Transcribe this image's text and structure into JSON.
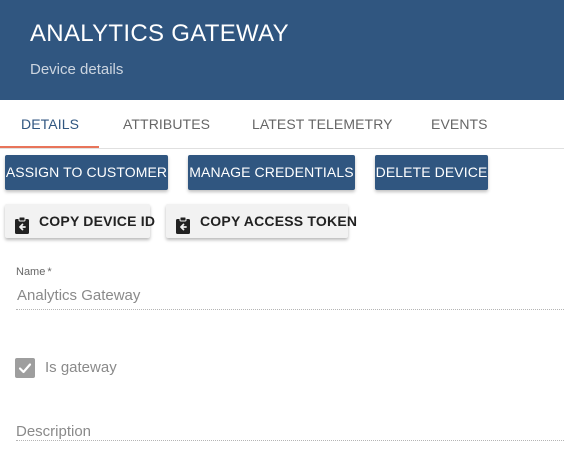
{
  "header": {
    "title": "ANALYTICS GATEWAY",
    "subtitle": "Device details",
    "background_color": "#305680"
  },
  "tabs": [
    {
      "label": "DETAILS",
      "active": true
    },
    {
      "label": "ATTRIBUTES",
      "active": false
    },
    {
      "label": "LATEST TELEMETRY",
      "active": false
    },
    {
      "label": "EVENTS",
      "active": false
    }
  ],
  "actions": {
    "assign_label": "ASSIGN TO CUSTOMER",
    "credentials_label": "MANAGE CREDENTIALS",
    "delete_label": "DELETE DEVICE",
    "copy_id_label": "COPY DEVICE ID",
    "copy_token_label": "COPY ACCESS TOKEN",
    "copy_icon": "clipboard-arrow-icon"
  },
  "form": {
    "name_label": "Name",
    "name_required_mark": "*",
    "name_value": "Analytics Gateway",
    "gateway_label": "Is gateway",
    "gateway_checked": true,
    "description_placeholder": "Description"
  },
  "colors": {
    "primary": "#305680",
    "tab_ink": "#e8745a"
  }
}
